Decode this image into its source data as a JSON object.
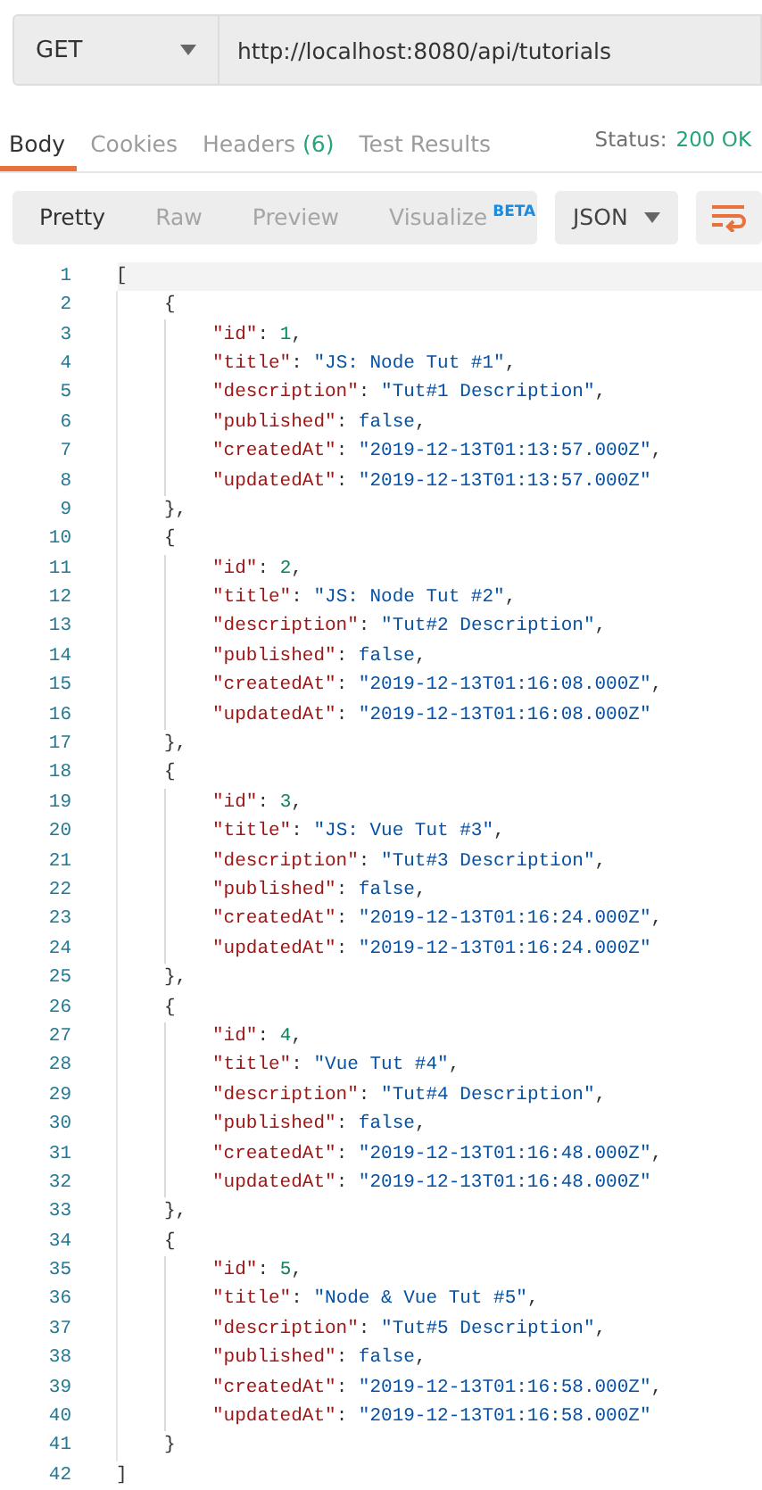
{
  "request": {
    "method": "GET",
    "url": "http://localhost:8080/api/tutorials"
  },
  "response_tabs": [
    {
      "label": "Body",
      "selected": true
    },
    {
      "label": "Cookies",
      "selected": false
    },
    {
      "label": "Headers",
      "count": "(6)",
      "selected": false
    },
    {
      "label": "Test Results",
      "selected": false
    }
  ],
  "status": {
    "label": "Status:",
    "value": "200 OK"
  },
  "view_modes": [
    {
      "label": "Pretty",
      "selected": true
    },
    {
      "label": "Raw",
      "selected": false
    },
    {
      "label": "Preview",
      "selected": false
    },
    {
      "label": "Visualize",
      "badge": "BETA",
      "selected": false
    }
  ],
  "format": "JSON",
  "wrap_active": true,
  "code_lines": [
    {
      "number": "1",
      "tokens": [
        {
          "kind": "punct",
          "text": "["
        }
      ],
      "active": true,
      "children": [
        {
          "number": "2",
          "tokens": [
            {
              "kind": "punct",
              "text": "{"
            }
          ],
          "children": [
            {
              "number": "3",
              "tokens": [
                {
                  "kind": "key",
                  "text": "\"id\""
                },
                {
                  "kind": "punct",
                  "text": ": "
                },
                {
                  "kind": "number",
                  "text": "1"
                },
                {
                  "kind": "punct",
                  "text": ","
                }
              ]
            },
            {
              "number": "4",
              "tokens": [
                {
                  "kind": "key",
                  "text": "\"title\""
                },
                {
                  "kind": "punct",
                  "text": ": "
                },
                {
                  "kind": "string",
                  "text": "\"JS: Node Tut #1\""
                },
                {
                  "kind": "punct",
                  "text": ","
                }
              ]
            },
            {
              "number": "5",
              "tokens": [
                {
                  "kind": "key",
                  "text": "\"description\""
                },
                {
                  "kind": "punct",
                  "text": ": "
                },
                {
                  "kind": "string",
                  "text": "\"Tut#1 Description\""
                },
                {
                  "kind": "punct",
                  "text": ","
                }
              ]
            },
            {
              "number": "6",
              "tokens": [
                {
                  "kind": "key",
                  "text": "\"published\""
                },
                {
                  "kind": "punct",
                  "text": ": "
                },
                {
                  "kind": "boolean",
                  "text": "false"
                },
                {
                  "kind": "punct",
                  "text": ","
                }
              ]
            },
            {
              "number": "7",
              "tokens": [
                {
                  "kind": "key",
                  "text": "\"createdAt\""
                },
                {
                  "kind": "punct",
                  "text": ": "
                },
                {
                  "kind": "string",
                  "text": "\"2019-12-13T01:13:57.000Z\""
                },
                {
                  "kind": "punct",
                  "text": ","
                }
              ]
            },
            {
              "number": "8",
              "tokens": [
                {
                  "kind": "key",
                  "text": "\"updatedAt\""
                },
                {
                  "kind": "punct",
                  "text": ": "
                },
                {
                  "kind": "string",
                  "text": "\"2019-12-13T01:13:57.000Z\""
                }
              ]
            }
          ]
        },
        {
          "number": "9",
          "tokens": [
            {
              "kind": "punct",
              "text": "},"
            }
          ]
        },
        {
          "number": "10",
          "tokens": [
            {
              "kind": "punct",
              "text": "{"
            }
          ],
          "children": [
            {
              "number": "11",
              "tokens": [
                {
                  "kind": "key",
                  "text": "\"id\""
                },
                {
                  "kind": "punct",
                  "text": ": "
                },
                {
                  "kind": "number",
                  "text": "2"
                },
                {
                  "kind": "punct",
                  "text": ","
                }
              ]
            },
            {
              "number": "12",
              "tokens": [
                {
                  "kind": "key",
                  "text": "\"title\""
                },
                {
                  "kind": "punct",
                  "text": ": "
                },
                {
                  "kind": "string",
                  "text": "\"JS: Node Tut #2\""
                },
                {
                  "kind": "punct",
                  "text": ","
                }
              ]
            },
            {
              "number": "13",
              "tokens": [
                {
                  "kind": "key",
                  "text": "\"description\""
                },
                {
                  "kind": "punct",
                  "text": ": "
                },
                {
                  "kind": "string",
                  "text": "\"Tut#2 Description\""
                },
                {
                  "kind": "punct",
                  "text": ","
                }
              ]
            },
            {
              "number": "14",
              "tokens": [
                {
                  "kind": "key",
                  "text": "\"published\""
                },
                {
                  "kind": "punct",
                  "text": ": "
                },
                {
                  "kind": "boolean",
                  "text": "false"
                },
                {
                  "kind": "punct",
                  "text": ","
                }
              ]
            },
            {
              "number": "15",
              "tokens": [
                {
                  "kind": "key",
                  "text": "\"createdAt\""
                },
                {
                  "kind": "punct",
                  "text": ": "
                },
                {
                  "kind": "string",
                  "text": "\"2019-12-13T01:16:08.000Z\""
                },
                {
                  "kind": "punct",
                  "text": ","
                }
              ]
            },
            {
              "number": "16",
              "tokens": [
                {
                  "kind": "key",
                  "text": "\"updatedAt\""
                },
                {
                  "kind": "punct",
                  "text": ": "
                },
                {
                  "kind": "string",
                  "text": "\"2019-12-13T01:16:08.000Z\""
                }
              ]
            }
          ]
        },
        {
          "number": "17",
          "tokens": [
            {
              "kind": "punct",
              "text": "},"
            }
          ]
        },
        {
          "number": "18",
          "tokens": [
            {
              "kind": "punct",
              "text": "{"
            }
          ],
          "children": [
            {
              "number": "19",
              "tokens": [
                {
                  "kind": "key",
                  "text": "\"id\""
                },
                {
                  "kind": "punct",
                  "text": ": "
                },
                {
                  "kind": "number",
                  "text": "3"
                },
                {
                  "kind": "punct",
                  "text": ","
                }
              ]
            },
            {
              "number": "20",
              "tokens": [
                {
                  "kind": "key",
                  "text": "\"title\""
                },
                {
                  "kind": "punct",
                  "text": ": "
                },
                {
                  "kind": "string",
                  "text": "\"JS: Vue Tut #3\""
                },
                {
                  "kind": "punct",
                  "text": ","
                }
              ]
            },
            {
              "number": "21",
              "tokens": [
                {
                  "kind": "key",
                  "text": "\"description\""
                },
                {
                  "kind": "punct",
                  "text": ": "
                },
                {
                  "kind": "string",
                  "text": "\"Tut#3 Description\""
                },
                {
                  "kind": "punct",
                  "text": ","
                }
              ]
            },
            {
              "number": "22",
              "tokens": [
                {
                  "kind": "key",
                  "text": "\"published\""
                },
                {
                  "kind": "punct",
                  "text": ": "
                },
                {
                  "kind": "boolean",
                  "text": "false"
                },
                {
                  "kind": "punct",
                  "text": ","
                }
              ]
            },
            {
              "number": "23",
              "tokens": [
                {
                  "kind": "key",
                  "text": "\"createdAt\""
                },
                {
                  "kind": "punct",
                  "text": ": "
                },
                {
                  "kind": "string",
                  "text": "\"2019-12-13T01:16:24.000Z\""
                },
                {
                  "kind": "punct",
                  "text": ","
                }
              ]
            },
            {
              "number": "24",
              "tokens": [
                {
                  "kind": "key",
                  "text": "\"updatedAt\""
                },
                {
                  "kind": "punct",
                  "text": ": "
                },
                {
                  "kind": "string",
                  "text": "\"2019-12-13T01:16:24.000Z\""
                }
              ]
            }
          ]
        },
        {
          "number": "25",
          "tokens": [
            {
              "kind": "punct",
              "text": "},"
            }
          ]
        },
        {
          "number": "26",
          "tokens": [
            {
              "kind": "punct",
              "text": "{"
            }
          ],
          "children": [
            {
              "number": "27",
              "tokens": [
                {
                  "kind": "key",
                  "text": "\"id\""
                },
                {
                  "kind": "punct",
                  "text": ": "
                },
                {
                  "kind": "number",
                  "text": "4"
                },
                {
                  "kind": "punct",
                  "text": ","
                }
              ]
            },
            {
              "number": "28",
              "tokens": [
                {
                  "kind": "key",
                  "text": "\"title\""
                },
                {
                  "kind": "punct",
                  "text": ": "
                },
                {
                  "kind": "string",
                  "text": "\"Vue Tut #4\""
                },
                {
                  "kind": "punct",
                  "text": ","
                }
              ]
            },
            {
              "number": "29",
              "tokens": [
                {
                  "kind": "key",
                  "text": "\"description\""
                },
                {
                  "kind": "punct",
                  "text": ": "
                },
                {
                  "kind": "string",
                  "text": "\"Tut#4 Description\""
                },
                {
                  "kind": "punct",
                  "text": ","
                }
              ]
            },
            {
              "number": "30",
              "tokens": [
                {
                  "kind": "key",
                  "text": "\"published\""
                },
                {
                  "kind": "punct",
                  "text": ": "
                },
                {
                  "kind": "boolean",
                  "text": "false"
                },
                {
                  "kind": "punct",
                  "text": ","
                }
              ]
            },
            {
              "number": "31",
              "tokens": [
                {
                  "kind": "key",
                  "text": "\"createdAt\""
                },
                {
                  "kind": "punct",
                  "text": ": "
                },
                {
                  "kind": "string",
                  "text": "\"2019-12-13T01:16:48.000Z\""
                },
                {
                  "kind": "punct",
                  "text": ","
                }
              ]
            },
            {
              "number": "32",
              "tokens": [
                {
                  "kind": "key",
                  "text": "\"updatedAt\""
                },
                {
                  "kind": "punct",
                  "text": ": "
                },
                {
                  "kind": "string",
                  "text": "\"2019-12-13T01:16:48.000Z\""
                }
              ]
            }
          ]
        },
        {
          "number": "33",
          "tokens": [
            {
              "kind": "punct",
              "text": "},"
            }
          ]
        },
        {
          "number": "34",
          "tokens": [
            {
              "kind": "punct",
              "text": "{"
            }
          ],
          "children": [
            {
              "number": "35",
              "tokens": [
                {
                  "kind": "key",
                  "text": "\"id\""
                },
                {
                  "kind": "punct",
                  "text": ": "
                },
                {
                  "kind": "number",
                  "text": "5"
                },
                {
                  "kind": "punct",
                  "text": ","
                }
              ]
            },
            {
              "number": "36",
              "tokens": [
                {
                  "kind": "key",
                  "text": "\"title\""
                },
                {
                  "kind": "punct",
                  "text": ": "
                },
                {
                  "kind": "string",
                  "text": "\"Node & Vue Tut #5\""
                },
                {
                  "kind": "punct",
                  "text": ","
                }
              ]
            },
            {
              "number": "37",
              "tokens": [
                {
                  "kind": "key",
                  "text": "\"description\""
                },
                {
                  "kind": "punct",
                  "text": ": "
                },
                {
                  "kind": "string",
                  "text": "\"Tut#5 Description\""
                },
                {
                  "kind": "punct",
                  "text": ","
                }
              ]
            },
            {
              "number": "38",
              "tokens": [
                {
                  "kind": "key",
                  "text": "\"published\""
                },
                {
                  "kind": "punct",
                  "text": ": "
                },
                {
                  "kind": "boolean",
                  "text": "false"
                },
                {
                  "kind": "punct",
                  "text": ","
                }
              ]
            },
            {
              "number": "39",
              "tokens": [
                {
                  "kind": "key",
                  "text": "\"createdAt\""
                },
                {
                  "kind": "punct",
                  "text": ": "
                },
                {
                  "kind": "string",
                  "text": "\"2019-12-13T01:16:58.000Z\""
                },
                {
                  "kind": "punct",
                  "text": ","
                }
              ]
            },
            {
              "number": "40",
              "tokens": [
                {
                  "kind": "key",
                  "text": "\"updatedAt\""
                },
                {
                  "kind": "punct",
                  "text": ": "
                },
                {
                  "kind": "string",
                  "text": "\"2019-12-13T01:16:58.000Z\""
                }
              ]
            }
          ]
        },
        {
          "number": "41",
          "tokens": [
            {
              "kind": "punct",
              "text": "}"
            }
          ]
        }
      ]
    },
    {
      "number": "42",
      "tokens": [
        {
          "kind": "punct",
          "text": "]"
        }
      ]
    }
  ]
}
